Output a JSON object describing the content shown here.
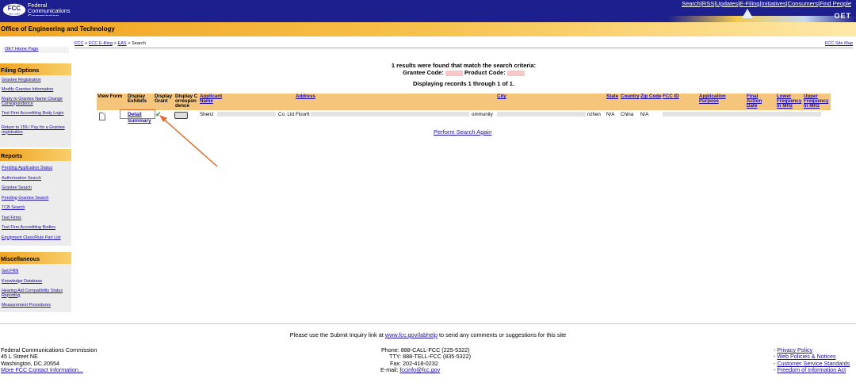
{
  "header": {
    "logo_text": "FCC",
    "logo_sub": "DEC 1934",
    "org_line1": "Federal",
    "org_line2": "Communications",
    "org_line3": "Commission",
    "links": [
      "Search",
      "RSS",
      "Updates",
      "E-Filing",
      "Initiatives",
      "Consumers",
      "Find People"
    ],
    "oet_label": "OET",
    "office_title": "Office of Engineering and Technology"
  },
  "breadcrumb": {
    "items": [
      "FCC",
      "FCC E-filing",
      "EAS"
    ],
    "current": "Search",
    "separator": ">",
    "site_map": "FCC Site Map"
  },
  "sidebar": {
    "home_link": "OET Home Page",
    "panels": [
      {
        "title": "Filing Options",
        "items": [
          "Grantee Registration",
          "Modify Grantee Information",
          "Reply to Grantee Name Change Correspondence",
          "Test Firm Accrediting Body Login",
          "Return to 159 / Pay for a Grantee registration"
        ]
      },
      {
        "title": "Reports",
        "items": [
          "Pending Application Status",
          "Authorization Search",
          "Grantee Search",
          "Pending Grantee Search",
          "TCB Search",
          "Test Firms",
          "Test Firm Accrediting Bodies",
          "Equipment Class/Rule Part List"
        ]
      },
      {
        "title": "Miscellaneous",
        "items": [
          "Get FRN",
          "Knowledge Database",
          "Hearing Aid Compatibility Status Reporting",
          "Measurement Procedures"
        ]
      }
    ]
  },
  "results": {
    "found_text": "1 results were found that match the search criteria:",
    "grantee_label": "Grantee Code:",
    "product_label": "Product Code:",
    "displaying_text": "Displaying records 1 through 1 of 1."
  },
  "table": {
    "headers": {
      "view_form": "View Form",
      "display_exhibits": "Display Exhibits",
      "display_grant": "Display Grant",
      "display_corr": "Display Correspondence",
      "applicant_name": "Applicant Name",
      "address": "Address",
      "city": "City",
      "state": "State",
      "country": "Country",
      "zip_code": "Zip Code",
      "fcc_id": "FCC ID",
      "application_purpose": "Application Purpose",
      "final_action_date": "Final Action Date",
      "lower_freq": "Lower Frequency In MHz",
      "upper_freq": "Upper Frequency In MHz"
    },
    "row": {
      "detail": "Detail",
      "summary": "Summary",
      "applicant_start": "Shenz",
      "applicant_end": "Co. Ltd",
      "address_start": "Floor6",
      "address_mid": "ommunity",
      "city_end": "nzhen",
      "state": "N/A",
      "country": "China",
      "zip": "N/A"
    },
    "perform_search_again": "Perform Search Again"
  },
  "footer": {
    "inquiry_pre": "Please use the Submit Inquiry link at",
    "inquiry_link": "www.fcc.gov/labhelp",
    "inquiry_post": "to send any comments or suggestions for this site",
    "address_lines": [
      "Federal Communications Commission",
      "45 L Street NE",
      "Washington, DC 20554"
    ],
    "more_info": "More FCC Contact Information...",
    "phone": "Phone: 888-CALL-FCC (225-5322)",
    "tty": "TTY: 888-TELL-FCC (835-5322)",
    "fax": "Fax: 202-418-0232",
    "email_label": "E-mail:",
    "email": "fccinfo@fcc.gov",
    "policy_links": [
      "Privacy Policy",
      "Web Policies & Notices",
      "Customer Service Standards",
      "Freedom of Information Act"
    ]
  }
}
